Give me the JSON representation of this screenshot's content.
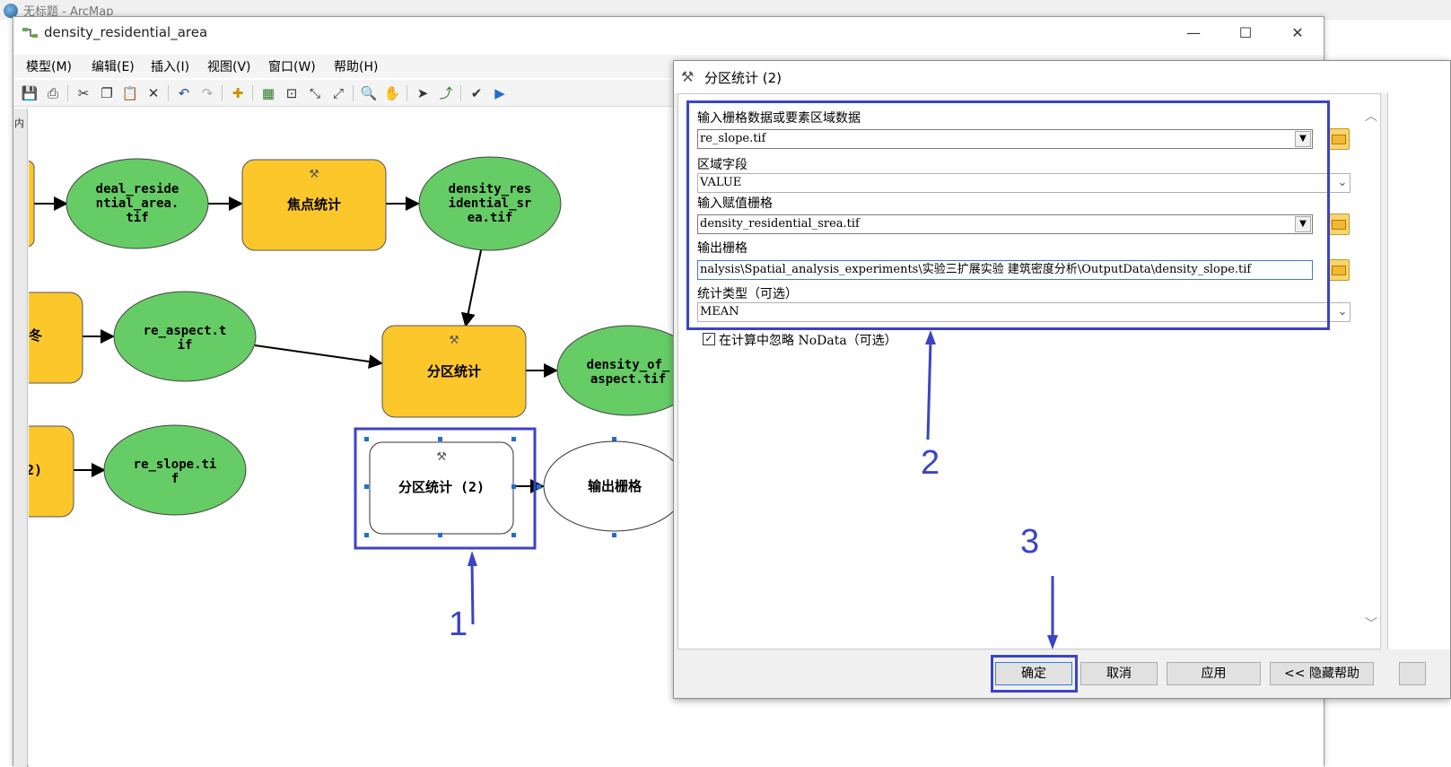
{
  "arcmap": {
    "title": "无标题 - ArcMap"
  },
  "window": {
    "title": "density_residential_area",
    "controls": {
      "minimize": "—",
      "maximize": "☐",
      "close": "✕"
    }
  },
  "menu": [
    {
      "label": "模型(M)"
    },
    {
      "label": "编辑(E)"
    },
    {
      "label": "插入(I)"
    },
    {
      "label": "视图(V)"
    },
    {
      "label": "窗口(W)"
    },
    {
      "label": "帮助(H)"
    }
  ],
  "left_strip": {
    "tab": "内"
  },
  "model": {
    "nodes": {
      "deal_residential": "deal_reside|ntial_area.|tif",
      "focal": "焦点统计",
      "density_residential": "density_res|idential_sr|ea.tif",
      "left_cut_1": "冬",
      "re_aspect": "re_aspect.t|if",
      "zonal": "分区统计",
      "density_aspect": "density_of_|aspect.tif",
      "left_cut_2": "2)",
      "re_slope": "re_slope.ti|f",
      "zonal2": "分区统计 (2)",
      "output": "输出栅格"
    },
    "colors": {
      "data": "#66cc66",
      "tool": "#fcc72b",
      "output": "#ffffff"
    }
  },
  "dialog": {
    "title": "分区统计 (2)",
    "fields": [
      {
        "label": "输入栅格数据或要素区域数据",
        "value": "re_slope.tif",
        "type": "dropdown-folder"
      },
      {
        "label": "区域字段",
        "value": "VALUE",
        "type": "select"
      },
      {
        "label": "输入赋值栅格",
        "value": "density_residential_srea.tif",
        "type": "dropdown-folder"
      },
      {
        "label": "输出栅格",
        "value": "nalysis\\Spatial_analysis_experiments\\实验三扩展实验 建筑密度分析\\OutputData\\density_slope.tif",
        "type": "folder"
      },
      {
        "label": "统计类型（可选）",
        "value": "MEAN",
        "type": "select"
      }
    ],
    "ignore_nodata": {
      "checked": true,
      "mark": "✓",
      "label": "在计算中忽略 NoData（可选）"
    },
    "buttons": {
      "ok": "确定",
      "cancel": "取消",
      "apply": "应用",
      "help": "<< 隐藏帮助"
    }
  },
  "annotations": {
    "n1": "1",
    "n2": "2",
    "n3": "3",
    "color": "#3b44c4"
  }
}
